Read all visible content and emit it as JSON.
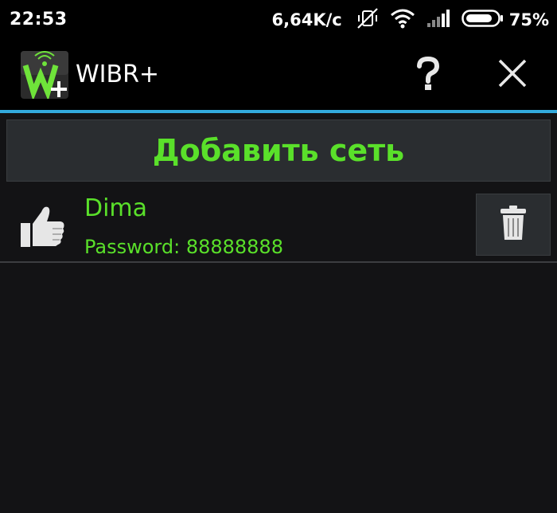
{
  "status_bar": {
    "time": "22:53",
    "net_speed": "6,64K/c",
    "battery": "75%",
    "icons": [
      "mute-vibrate-off-icon",
      "wifi-icon",
      "signal-icon",
      "battery-icon"
    ]
  },
  "action_bar": {
    "title": "WIBR+",
    "logo_icon": "wibr-logo-icon",
    "help_icon": "help-icon",
    "close_icon": "close-icon"
  },
  "main": {
    "add_network_label": "Добавить сеть",
    "networks": [
      {
        "name": "Dima",
        "password_text": "Password: 88888888",
        "status_icon": "thumbs-up-icon",
        "delete_icon": "trash-icon"
      }
    ]
  },
  "colors": {
    "accent": "#33aadd",
    "text_green": "#5ae02a",
    "background": "#131315"
  }
}
